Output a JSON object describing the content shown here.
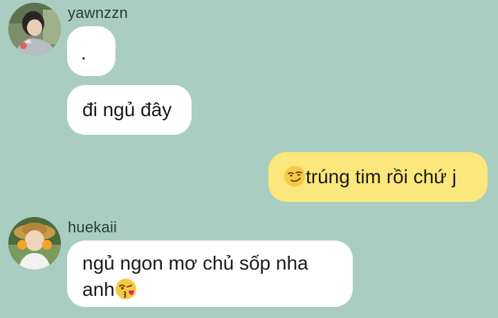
{
  "messages": [
    {
      "sender": "yawnzzn",
      "direction": "incoming",
      "texts": [
        ".",
        "đi ngủ đây"
      ]
    },
    {
      "sender": "me",
      "direction": "outgoing",
      "emoji": "smirking-face",
      "text": "trúng tim rồi chứ j"
    },
    {
      "sender": "huekaii",
      "direction": "incoming",
      "line1": "ngủ ngon mơ chủ sốp nha",
      "line2": "anh",
      "emoji": "face-blowing-kiss"
    }
  ],
  "colors": {
    "background": "#a9cdc0",
    "incoming_bubble": "#ffffff",
    "outgoing_bubble": "#fbe77b"
  },
  "icons": {
    "avatar1": "user-avatar-photo",
    "avatar2": "user-avatar-photo"
  }
}
